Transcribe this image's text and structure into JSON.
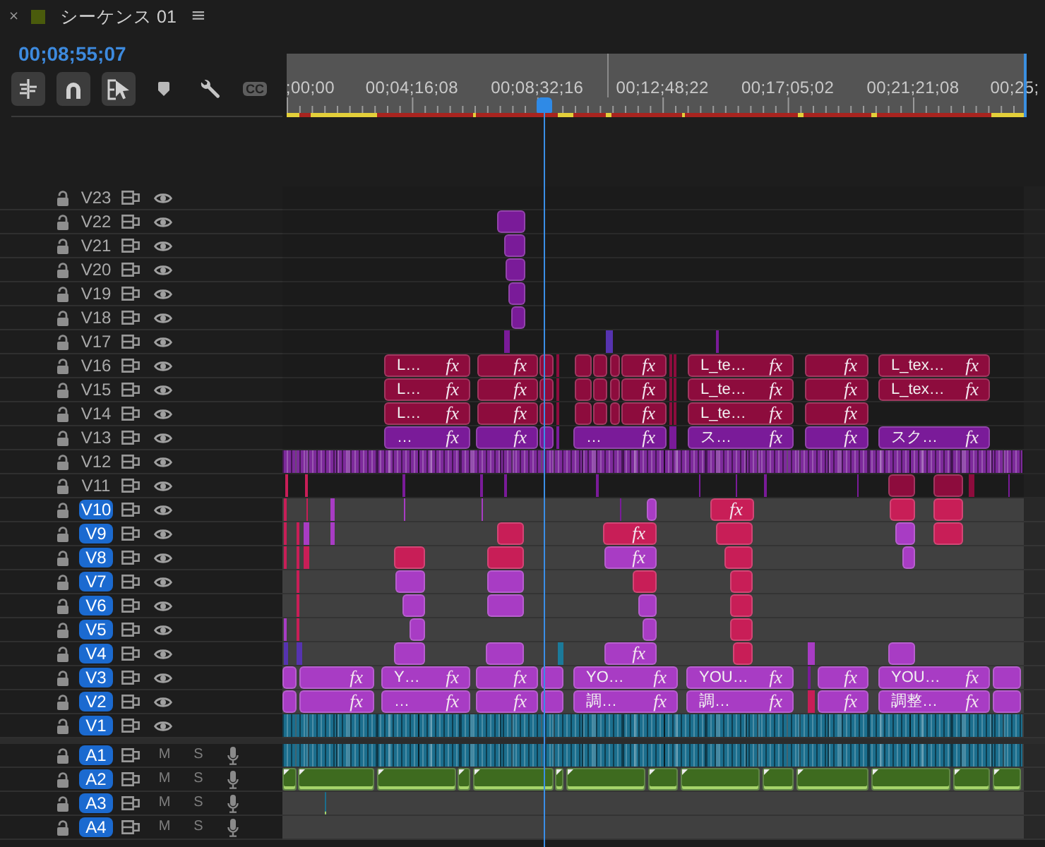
{
  "panel": {
    "close": "×",
    "title": "シーケンス 01",
    "menu": "≡"
  },
  "timecode": "00;08;55;07",
  "toolbar": [
    {
      "kind": "nest",
      "on": true
    },
    {
      "kind": "snap",
      "on": true
    },
    {
      "kind": "linked",
      "on": true
    },
    {
      "kind": "marker"
    },
    {
      "kind": "settings"
    },
    {
      "kind": "captions",
      "label": "CC"
    }
  ],
  "ruler": {
    "labels": [
      ";00;00",
      "00;04;16;08",
      "00;08;32;16",
      "00;12;48;22",
      "00;17;05;02",
      "00;21;21;08",
      "00;25;"
    ]
  },
  "playhead": {
    "level": 0.35
  },
  "video_tracks": [
    {
      "label": "V23",
      "locked": false,
      "targeted": false,
      "visible": true
    },
    {
      "label": "V22",
      "locked": false,
      "targeted": false,
      "visible": true,
      "clips": [
        {
          "kind": "clip",
          "color": "#7a1b99"
        }
      ]
    },
    {
      "label": "V21",
      "locked": false,
      "targeted": false,
      "visible": true,
      "clips": [
        {
          "kind": "clip",
          "color": "#7a1b99"
        }
      ]
    },
    {
      "label": "V20",
      "locked": false,
      "targeted": false,
      "visible": true,
      "clips": [
        {
          "kind": "clip",
          "color": "#7a1b99"
        }
      ]
    },
    {
      "label": "V19",
      "locked": false,
      "targeted": false,
      "visible": true,
      "clips": [
        {
          "kind": "clip",
          "color": "#7a1b99"
        }
      ]
    },
    {
      "label": "V18",
      "locked": false,
      "targeted": false,
      "visible": true,
      "clips": [
        {
          "kind": "clip",
          "color": "#7a1b99"
        }
      ]
    },
    {
      "label": "V17",
      "locked": false,
      "targeted": false,
      "visible": true,
      "clips": [
        {
          "kind": "clip",
          "color": "#7a1b99"
        },
        {
          "kind": "clip",
          "color": "#5633b0"
        },
        {
          "kind": "clip",
          "color": "#7a1b99"
        }
      ]
    },
    {
      "label": "V16",
      "locked": false,
      "targeted": false,
      "visible": true,
      "clips": [
        {
          "kind": "clip",
          "color": "#8d0c3d",
          "name": "L…",
          "fx": "fx"
        },
        {
          "kind": "clip",
          "color": "#8d0c3d",
          "fx": "fx"
        },
        {
          "kind": "clip",
          "color": "#8d0c3d"
        },
        {
          "kind": "clip",
          "color": "#8d0c3d"
        },
        {
          "kind": "clip",
          "color": "#8d0c3d"
        },
        {
          "kind": "clip",
          "color": "#8d0c3d"
        },
        {
          "kind": "clip",
          "color": "#8d0c3d"
        },
        {
          "kind": "clip",
          "color": "#8d0c3d",
          "fx": "fx"
        },
        {
          "kind": "clip",
          "color": "#8d0c3d"
        },
        {
          "kind": "clip",
          "color": "#8d0c3d"
        },
        {
          "kind": "clip",
          "color": "#8d0c3d",
          "name": "L_te…",
          "fx": "fx"
        },
        {
          "kind": "clip",
          "color": "#8d0c3d",
          "fx": "fx"
        },
        {
          "kind": "clip",
          "color": "#8d0c3d",
          "name": "L_tex…",
          "fx": "fx"
        }
      ]
    },
    {
      "label": "V15",
      "locked": false,
      "targeted": false,
      "visible": true,
      "clips": [
        {
          "kind": "clip",
          "color": "#8d0c3d",
          "name": "L…",
          "fx": "fx"
        },
        {
          "kind": "clip",
          "color": "#8d0c3d",
          "fx": "fx"
        },
        {
          "kind": "clip",
          "color": "#8d0c3d"
        },
        {
          "kind": "clip",
          "color": "#8d0c3d"
        },
        {
          "kind": "clip",
          "color": "#8d0c3d"
        },
        {
          "kind": "clip",
          "color": "#8d0c3d"
        },
        {
          "kind": "clip",
          "color": "#8d0c3d"
        },
        {
          "kind": "clip",
          "color": "#8d0c3d",
          "fx": "fx"
        },
        {
          "kind": "clip",
          "color": "#8d0c3d"
        },
        {
          "kind": "clip",
          "color": "#8d0c3d"
        },
        {
          "kind": "clip",
          "color": "#8d0c3d",
          "name": "L_te…",
          "fx": "fx"
        },
        {
          "kind": "clip",
          "color": "#8d0c3d",
          "fx": "fx"
        },
        {
          "kind": "clip",
          "color": "#8d0c3d",
          "name": "L_tex…",
          "fx": "fx"
        }
      ]
    },
    {
      "label": "V14",
      "locked": false,
      "targeted": false,
      "visible": true,
      "clips": [
        {
          "kind": "clip",
          "color": "#8d0c3d",
          "name": "L…",
          "fx": "fx"
        },
        {
          "kind": "clip",
          "color": "#8d0c3d",
          "fx": "fx"
        },
        {
          "kind": "clip",
          "color": "#8d0c3d"
        },
        {
          "kind": "clip",
          "color": "#8d0c3d"
        },
        {
          "kind": "clip",
          "color": "#8d0c3d"
        },
        {
          "kind": "clip",
          "color": "#8d0c3d"
        },
        {
          "kind": "clip",
          "color": "#8d0c3d"
        },
        {
          "kind": "clip",
          "color": "#8d0c3d",
          "fx": "fx"
        },
        {
          "kind": "clip",
          "color": "#8d0c3d"
        },
        {
          "kind": "clip",
          "color": "#8d0c3d"
        },
        {
          "kind": "clip",
          "color": "#8d0c3d",
          "name": "L_te…",
          "fx": "fx"
        },
        {
          "kind": "clip",
          "color": "#8d0c3d",
          "fx": "fx"
        }
      ]
    },
    {
      "label": "V13",
      "locked": false,
      "targeted": false,
      "visible": true,
      "clips": [
        {
          "kind": "clip",
          "color": "#7a1b99",
          "name": "…",
          "fx": "fx"
        },
        {
          "kind": "clip",
          "color": "#7a1b99",
          "fx": "fx"
        },
        {
          "kind": "clip",
          "color": "#7a1b99"
        },
        {
          "kind": "clip",
          "color": "#7a1b99"
        },
        {
          "kind": "clip",
          "color": "#7a1b99",
          "name": "…",
          "fx": "fx"
        },
        {
          "kind": "clip",
          "color": "#7a1b99"
        },
        {
          "kind": "clip",
          "color": "#7a1b99",
          "name": "ス…",
          "fx": "fx"
        },
        {
          "kind": "clip",
          "color": "#7a1b99",
          "fx": "fx"
        },
        {
          "kind": "clip",
          "color": "#7a1b99",
          "name": "スク…",
          "fx": "fx"
        }
      ]
    },
    {
      "label": "V12",
      "locked": false,
      "targeted": false,
      "visible": true,
      "clips": [
        {
          "kind": "dense",
          "color": "#7d2a9b"
        }
      ]
    },
    {
      "label": "V11",
      "locked": false,
      "targeted": false,
      "visible": true,
      "clips": [
        {
          "kind": "clip",
          "color": "#c81e57"
        },
        {
          "kind": "clip",
          "color": "#c81e57"
        },
        {
          "kind": "clip",
          "color": "#7a1b99"
        },
        {
          "kind": "clip",
          "color": "#7a1b99"
        },
        {
          "kind": "clip",
          "color": "#7a1b99"
        },
        {
          "kind": "clip",
          "color": "#7a1b99"
        },
        {
          "kind": "clip",
          "color": "#7a1b99"
        },
        {
          "kind": "clip",
          "color": "#7a1b99"
        },
        {
          "kind": "clip",
          "color": "#7a1b99"
        },
        {
          "kind": "clip",
          "color": "#7a1b99"
        },
        {
          "kind": "clip",
          "color": "#8d0c3d"
        },
        {
          "kind": "clip",
          "color": "#8d0c3d"
        },
        {
          "kind": "clip",
          "color": "#8d0c3d"
        },
        {
          "kind": "clip",
          "color": "#7a1b99"
        }
      ]
    },
    {
      "label": "V10",
      "locked": false,
      "targeted": true,
      "visible": true,
      "clips": [
        {
          "kind": "clip",
          "color": "#c81e57"
        },
        {
          "kind": "clip",
          "color": "#c81e57"
        },
        {
          "kind": "clip",
          "color": "#a83cc4"
        },
        {
          "kind": "clip",
          "color": "#a83cc4"
        },
        {
          "kind": "clip",
          "color": "#a83cc4"
        },
        {
          "kind": "clip",
          "color": "#7a1b99"
        },
        {
          "kind": "clip",
          "color": "#a83cc4"
        },
        {
          "kind": "clip",
          "color": "#c81e57",
          "fx": "fx"
        },
        {
          "kind": "clip",
          "color": "#c81e57"
        },
        {
          "kind": "clip",
          "color": "#c81e57"
        }
      ]
    },
    {
      "label": "V9",
      "locked": false,
      "targeted": true,
      "visible": true,
      "clips": [
        {
          "kind": "clip",
          "color": "#c81e57"
        },
        {
          "kind": "clip",
          "color": "#c81e57"
        },
        {
          "kind": "clip",
          "color": "#a83cc4"
        },
        {
          "kind": "clip",
          "color": "#a83cc4"
        },
        {
          "kind": "clip",
          "color": "#c81e57"
        },
        {
          "kind": "clip",
          "color": "#c81e57",
          "fx": "fx"
        },
        {
          "kind": "clip",
          "color": "#c81e57"
        },
        {
          "kind": "clip",
          "color": "#a83cc4"
        },
        {
          "kind": "clip",
          "color": "#c81e57"
        }
      ]
    },
    {
      "label": "V8",
      "locked": false,
      "targeted": true,
      "visible": true,
      "clips": [
        {
          "kind": "clip",
          "color": "#c81e57"
        },
        {
          "kind": "clip",
          "color": "#c81e57"
        },
        {
          "kind": "clip",
          "color": "#c81e57"
        },
        {
          "kind": "clip",
          "color": "#c81e57"
        },
        {
          "kind": "clip",
          "color": "#c81e57"
        },
        {
          "kind": "clip",
          "color": "#a83cc4",
          "fx": "fx"
        },
        {
          "kind": "clip",
          "color": "#c81e57"
        },
        {
          "kind": "clip",
          "color": "#a83cc4"
        }
      ]
    },
    {
      "label": "V7",
      "locked": false,
      "targeted": true,
      "visible": true,
      "clips": [
        {
          "kind": "clip",
          "color": "#c81e57"
        },
        {
          "kind": "clip",
          "color": "#a83cc4"
        },
        {
          "kind": "clip",
          "color": "#a83cc4"
        },
        {
          "kind": "clip",
          "color": "#c81e57"
        },
        {
          "kind": "clip",
          "color": "#c81e57"
        }
      ]
    },
    {
      "label": "V6",
      "locked": false,
      "targeted": true,
      "visible": true,
      "clips": [
        {
          "kind": "clip",
          "color": "#c81e57"
        },
        {
          "kind": "clip",
          "color": "#a83cc4"
        },
        {
          "kind": "clip",
          "color": "#a83cc4"
        },
        {
          "kind": "clip",
          "color": "#a83cc4"
        },
        {
          "kind": "clip",
          "color": "#c81e57"
        }
      ]
    },
    {
      "label": "V5",
      "locked": false,
      "targeted": true,
      "visible": true,
      "clips": [
        {
          "kind": "clip",
          "color": "#a83cc4"
        },
        {
          "kind": "clip",
          "color": "#c81e57"
        },
        {
          "kind": "clip",
          "color": "#a83cc4"
        },
        {
          "kind": "clip",
          "color": "#a83cc4"
        },
        {
          "kind": "clip",
          "color": "#c81e57"
        }
      ]
    },
    {
      "label": "V4",
      "locked": false,
      "targeted": true,
      "visible": true,
      "clips": [
        {
          "kind": "clip",
          "color": "#5633b0"
        },
        {
          "kind": "clip",
          "color": "#5633b0"
        },
        {
          "kind": "clip",
          "color": "#a83cc4"
        },
        {
          "kind": "clip",
          "color": "#a83cc4"
        },
        {
          "kind": "clip",
          "color": "#1b7a9a"
        },
        {
          "kind": "clip",
          "color": "#a83cc4",
          "fx": "fx"
        },
        {
          "kind": "clip",
          "color": "#c81e57"
        },
        {
          "kind": "clip",
          "color": "#a83cc4"
        },
        {
          "kind": "clip",
          "color": "#a83cc4"
        }
      ]
    },
    {
      "label": "V3",
      "locked": false,
      "targeted": true,
      "visible": true,
      "clips": [
        {
          "kind": "clip",
          "color": "#a83cc4"
        },
        {
          "kind": "clip",
          "color": "#a83cc4",
          "fx": "fx"
        },
        {
          "kind": "clip",
          "color": "#a83cc4",
          "name": "Y…",
          "fx": "fx"
        },
        {
          "kind": "clip",
          "color": "#a83cc4",
          "fx": "fx"
        },
        {
          "kind": "clip",
          "color": "#a83cc4"
        },
        {
          "kind": "clip",
          "color": "#a83cc4",
          "name": "YO…",
          "fx": "fx"
        },
        {
          "kind": "clip",
          "color": "#a83cc4",
          "name": "YOU…",
          "fx": "fx"
        },
        {
          "kind": "clip",
          "color": "#7a1b99"
        },
        {
          "kind": "clip",
          "color": "#a83cc4",
          "fx": "fx"
        },
        {
          "kind": "clip",
          "color": "#a83cc4",
          "name": "YOU…",
          "fx": "fx"
        },
        {
          "kind": "clip",
          "color": "#a83cc4"
        }
      ]
    },
    {
      "label": "V2",
      "locked": false,
      "targeted": true,
      "visible": true,
      "clips": [
        {
          "kind": "clip",
          "color": "#a83cc4"
        },
        {
          "kind": "clip",
          "color": "#a83cc4",
          "fx": "fx"
        },
        {
          "kind": "clip",
          "color": "#a83cc4",
          "name": "…",
          "fx": "fx"
        },
        {
          "kind": "clip",
          "color": "#a83cc4",
          "fx": "fx"
        },
        {
          "kind": "clip",
          "color": "#a83cc4"
        },
        {
          "kind": "clip",
          "color": "#a83cc4",
          "name": "調…",
          "fx": "fx"
        },
        {
          "kind": "clip",
          "color": "#a83cc4",
          "name": "調…",
          "fx": "fx"
        },
        {
          "kind": "clip",
          "color": "#c81e57"
        },
        {
          "kind": "clip",
          "color": "#a83cc4",
          "fx": "fx"
        },
        {
          "kind": "clip",
          "color": "#a83cc4",
          "name": "調整…",
          "fx": "fx"
        },
        {
          "kind": "clip",
          "color": "#a83cc4"
        }
      ]
    },
    {
      "label": "V1",
      "locked": false,
      "targeted": true,
      "visible": true,
      "clips": [
        {
          "kind": "dense",
          "color": "#1b6e8d"
        }
      ]
    }
  ],
  "audio_tracks": [
    {
      "label": "A1",
      "locked": false,
      "targeted": true,
      "mute": "M",
      "solo": "S",
      "muted": false,
      "soloed": false,
      "clips": [
        {
          "kind": "dense",
          "color": "#1b6e8d"
        }
      ]
    },
    {
      "label": "A2",
      "locked": false,
      "targeted": true,
      "mute": "M",
      "solo": "S",
      "muted": false,
      "soloed": false,
      "clips": [
        {
          "kind": "clip",
          "color": "#3e6b1f"
        },
        {
          "kind": "clip",
          "color": "#3e6b1f"
        },
        {
          "kind": "clip",
          "color": "#3e6b1f"
        },
        {
          "kind": "clip",
          "color": "#3e6b1f"
        },
        {
          "kind": "clip",
          "color": "#3e6b1f"
        },
        {
          "kind": "clip",
          "color": "#3e6b1f"
        },
        {
          "kind": "clip",
          "color": "#3e6b1f"
        },
        {
          "kind": "clip",
          "color": "#3e6b1f"
        },
        {
          "kind": "clip",
          "color": "#3e6b1f"
        },
        {
          "kind": "clip",
          "color": "#3e6b1f"
        },
        {
          "kind": "clip",
          "color": "#3e6b1f"
        },
        {
          "kind": "clip",
          "color": "#3e6b1f"
        },
        {
          "kind": "clip",
          "color": "#3e6b1f"
        },
        {
          "kind": "clip",
          "color": "#3e6b1f"
        }
      ]
    },
    {
      "label": "A3",
      "locked": false,
      "targeted": true,
      "mute": "M",
      "solo": "S",
      "muted": false,
      "soloed": false,
      "clips": [
        {
          "kind": "clip",
          "color": "#1b6e8d"
        }
      ]
    },
    {
      "label": "A4",
      "locked": false,
      "targeted": true,
      "mute": "M",
      "solo": "S",
      "muted": false,
      "soloed": false
    }
  ]
}
